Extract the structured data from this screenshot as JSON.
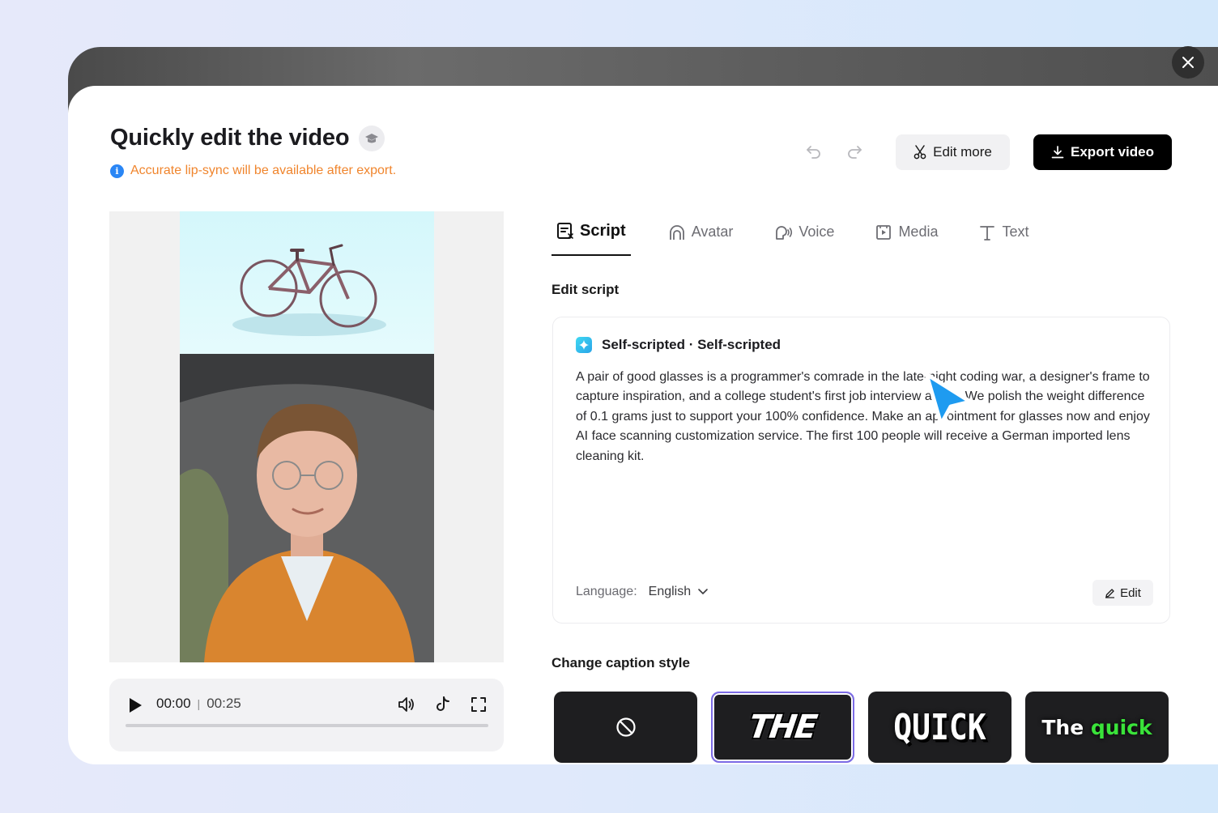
{
  "header": {
    "title": "Quickly edit the video",
    "notice": "Accurate lip-sync will be available after export.",
    "edit_more_label": "Edit more",
    "export_label": "Export video"
  },
  "player": {
    "current_time": "00:00",
    "separator": "|",
    "duration": "00:25",
    "progress": 0
  },
  "tabs": [
    {
      "label": "Script",
      "active": true
    },
    {
      "label": "Avatar",
      "active": false
    },
    {
      "label": "Voice",
      "active": false
    },
    {
      "label": "Media",
      "active": false
    },
    {
      "label": "Text",
      "active": false
    }
  ],
  "script": {
    "section_title": "Edit script",
    "source_label": "Self-scripted · Self-scripted",
    "text": "A pair of good glasses is a programmer's comrade in the late-night coding war, a designer's frame to capture inspiration, and a college student's first job interview armor. We polish the weight difference of 0.1 grams just to support your 100% confidence. Make an appointment for glasses now and enjoy AI face scanning customization service. The first 100 people will receive a German imported lens cleaning kit.",
    "language_label": "Language:",
    "language_value": "English",
    "edit_label": "Edit"
  },
  "captions": {
    "section_title": "Change caption style",
    "styles": [
      {
        "name": "none",
        "icon": "ban-icon"
      },
      {
        "label": "THE",
        "selected": true
      },
      {
        "label": "QUICK"
      },
      {
        "label_word1": "The",
        "label_word2": "quick"
      }
    ]
  },
  "colors": {
    "accent_orange": "#f0852d",
    "info_blue": "#2a86f5",
    "selected_border": "#7c6be6",
    "cursor_blue": "#1e9bf0",
    "caption_green": "#3ae33a"
  }
}
